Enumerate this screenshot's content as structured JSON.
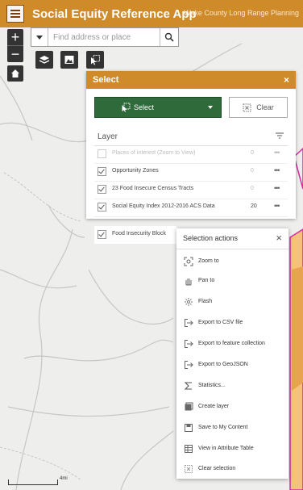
{
  "header": {
    "title": "Social Equity Reference App",
    "org": "Wake County Long Range Planning"
  },
  "zoom": {
    "in_label": "+",
    "out_label": "−"
  },
  "search": {
    "placeholder": "Find address or place"
  },
  "select_panel": {
    "title": "Select",
    "close_label": "×",
    "select_label": "Select",
    "clear_label": "Clear",
    "layer_header": "Layer",
    "layers": [
      {
        "name": "Places of Interest (Zoom to View)",
        "count": "0",
        "checked": false,
        "disabled": true
      },
      {
        "name": "Opportunity Zones",
        "count": "0",
        "checked": true,
        "disabled": false
      },
      {
        "name": "23 Food Insecure Census Tracts",
        "count": "0",
        "checked": true,
        "disabled": false
      },
      {
        "name": "Social Equity Index 2012-2016 ACS Data",
        "count": "20",
        "checked": true,
        "disabled": false
      },
      {
        "name": "Food Insecurity Block",
        "count": "",
        "checked": true,
        "disabled": false
      }
    ],
    "more_label": "•••"
  },
  "selection_menu": {
    "title": "Selection actions",
    "close_label": "×",
    "items": [
      {
        "label": "Zoom to",
        "icon": "zoom-to-icon"
      },
      {
        "label": "Pan to",
        "icon": "pan-icon"
      },
      {
        "label": "Flash",
        "icon": "flash-icon"
      },
      {
        "label": "Export to CSV file",
        "icon": "export-icon"
      },
      {
        "label": "Export to feature collection",
        "icon": "export-icon"
      },
      {
        "label": "Export to GeoJSON",
        "icon": "export-icon"
      },
      {
        "label": "Statistics...",
        "icon": "sigma-icon"
      },
      {
        "label": "Create layer",
        "icon": "layer-icon"
      },
      {
        "label": "Save to My Content",
        "icon": "save-icon"
      },
      {
        "label": "View in Attribute Table",
        "icon": "table-icon"
      },
      {
        "label": "Clear selection",
        "icon": "clear-icon"
      }
    ]
  },
  "scale": {
    "label": "4mi"
  },
  "colors": {
    "header": "#cf8a2a",
    "select_button": "#2f6a3b",
    "highlight": "#d62ba0"
  }
}
